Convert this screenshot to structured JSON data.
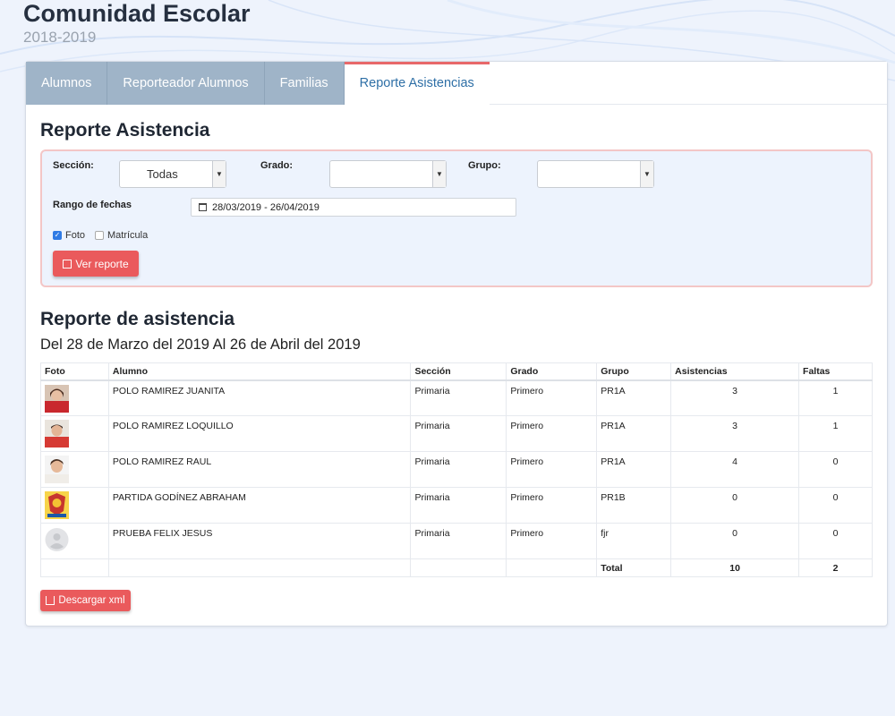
{
  "header": {
    "title": "Comunidad Escolar",
    "subtitle": "2018-2019"
  },
  "tabs": [
    {
      "label": "Alumnos",
      "active": false
    },
    {
      "label": "Reporteador Alumnos",
      "active": false
    },
    {
      "label": "Familias",
      "active": false
    },
    {
      "label": "Reporte Asistencias",
      "active": true
    }
  ],
  "filters": {
    "title": "Reporte Asistencia",
    "seccion_label": "Sección:",
    "seccion_value": "Todas",
    "grado_label": "Grado:",
    "grado_value": "",
    "grupo_label": "Grupo:",
    "grupo_value": "",
    "rango_label": "Rango de fechas",
    "rango_value": "28/03/2019 - 26/04/2019",
    "foto_label": "Foto",
    "foto_checked": true,
    "matricula_label": "Matrícula",
    "matricula_checked": false,
    "ver_reporte_label": "Ver reporte"
  },
  "report": {
    "title": "Reporte de asistencia",
    "subtitle": "Del 28 de Marzo del 2019 Al 26 de Abril del 2019",
    "columns": [
      "Foto",
      "Alumno",
      "Sección",
      "Grado",
      "Grupo",
      "Asistencias",
      "Faltas"
    ],
    "rows": [
      {
        "alumno": "POLO RAMIREZ JUANITA",
        "seccion": "Primaria",
        "grado": "Primero",
        "grupo": "PR1A",
        "asistencias": "3",
        "faltas": "1",
        "photo": "girl-red-photo"
      },
      {
        "alumno": "POLO RAMIREZ LOQUILLO",
        "seccion": "Primaria",
        "grado": "Primero",
        "grupo": "PR1A",
        "asistencias": "3",
        "faltas": "1",
        "photo": "boy-red-photo"
      },
      {
        "alumno": "POLO RAMIREZ RAUL",
        "seccion": "Primaria",
        "grado": "Primero",
        "grupo": "PR1A",
        "asistencias": "4",
        "faltas": "0",
        "photo": "boy-white-photo"
      },
      {
        "alumno": "PARTIDA GODÍNEZ ABRAHAM",
        "seccion": "Primaria",
        "grado": "Primero",
        "grupo": "PR1B",
        "asistencias": "0",
        "faltas": "0",
        "photo": "badge-photo"
      },
      {
        "alumno": "PRUEBA FELIX JESUS",
        "seccion": "Primaria",
        "grado": "Primero",
        "grupo": "fjr",
        "asistencias": "0",
        "faltas": "0",
        "photo": "default-avatar"
      }
    ],
    "total_label": "Total",
    "total_asistencias": "10",
    "total_faltas": "2",
    "download_label": "Descargar xml"
  },
  "colors": {
    "accent": "#ea5a5c",
    "tab_bg": "#9fb4c8",
    "tab_active_text": "#2e6fa6",
    "filter_bg": "#edf3fd"
  }
}
